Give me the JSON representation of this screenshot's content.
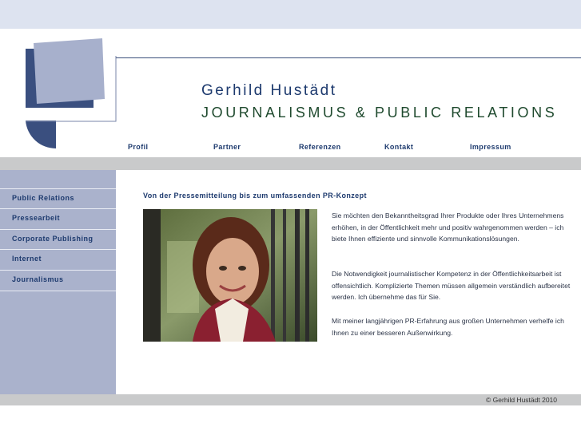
{
  "header": {
    "name": "Gerhild Hustädt",
    "tagline": "JOURNALISMUS & PUBLIC RELATIONS"
  },
  "nav": {
    "items": [
      "Profil",
      "Partner",
      "Referenzen",
      "Kontakt",
      "Impressum"
    ]
  },
  "sidebar": {
    "items": [
      "Public Relations",
      "Pressearbeit",
      "Corporate Publishing",
      "Internet",
      "Journalismus"
    ]
  },
  "main": {
    "heading": "Von der Pressemitteilung bis zum umfassenden PR-Konzept",
    "paragraphs": [
      "Sie möchten den Bekanntheitsgrad Ihrer Produkte oder Ihres Unternehmens erhöhen, in der Öffentlichkeit mehr und positiv wahrgenommen werden – ich biete Ihnen effiziente und sinnvolle Kommunikationslösungen.",
      "Die Notwendigkeit journalistischer Kompetenz in der Öffentlichkeitsarbeit ist offensichtlich. Komplizierte Themen müssen allgemein verständlich aufbereitet werden. Ich übernehme das für Sie.",
      "Mit meiner langjährigen PR-Erfahrung aus großen Unternehmen verhelfe ich Ihnen zu einer besseren Außenwirkung."
    ]
  },
  "footer": {
    "copyright": "© Gerhild Hustädt 2010"
  },
  "colors": {
    "top_band": "#dde3f0",
    "logo_dark": "#3a4f7f",
    "logo_light": "#a7b0cc",
    "sidebar": "#aab2cc",
    "gray_band": "#c9cacb",
    "nav_text": "#1d3a6e",
    "tagline_text": "#1f4a2e"
  },
  "icons": {
    "logo": "overlapping-squares-logo",
    "photo": "portrait-photo"
  }
}
